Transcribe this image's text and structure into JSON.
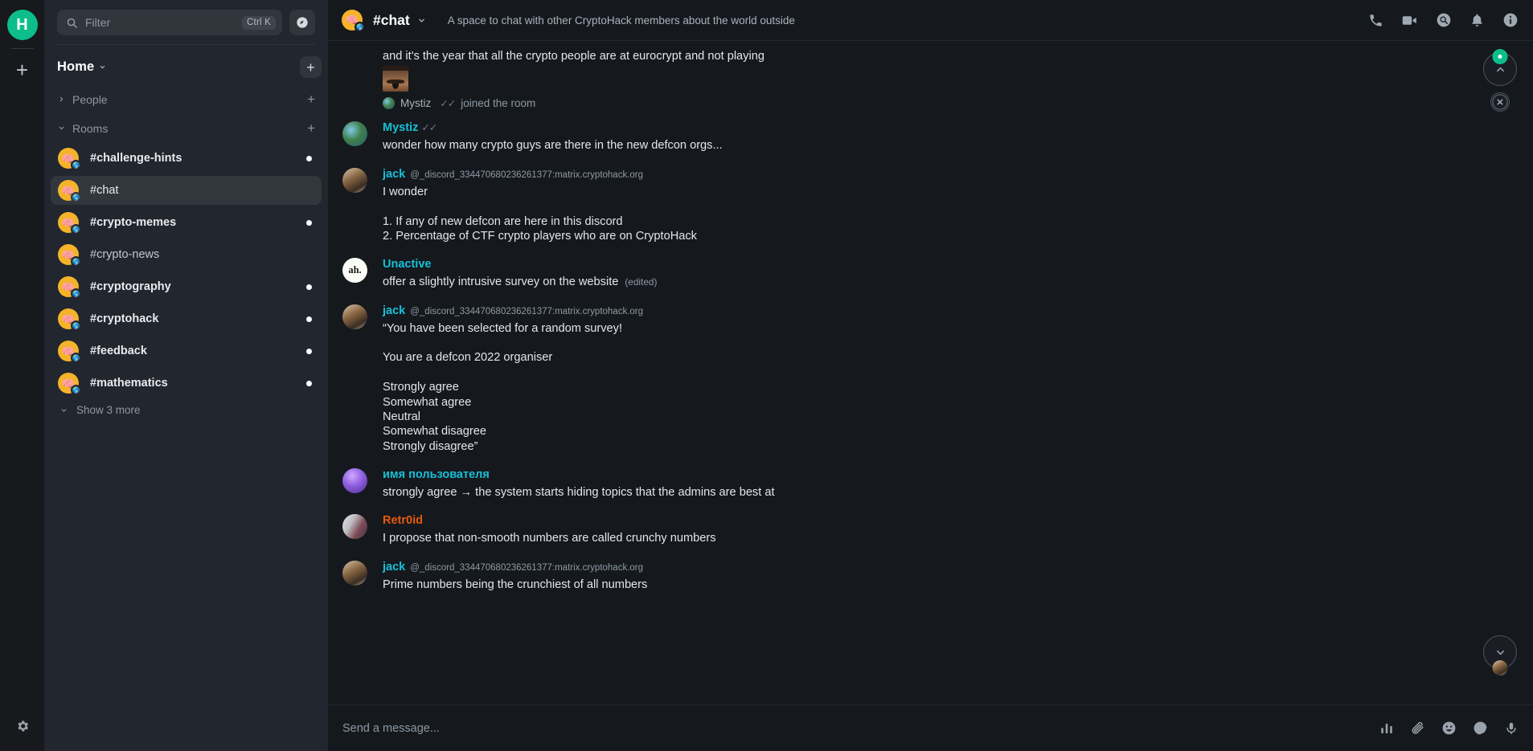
{
  "rail": {
    "home_space_label": "H",
    "add_space_label": "+",
    "settings_icon": "gear-icon"
  },
  "sidebar": {
    "search": {
      "placeholder": "Filter",
      "shortcut": "Ctrl K",
      "icon": "search-icon"
    },
    "explore_icon": "explore-compass-icon",
    "home_label": "Home",
    "home_caret_icon": "chevron-down-icon",
    "add_label": "+",
    "sections": [
      {
        "label": "People",
        "collapsed": true,
        "caret_icon": "chevron-right-icon",
        "add_label": "+"
      },
      {
        "label": "Rooms",
        "collapsed": false,
        "caret_icon": "chevron-down-icon",
        "add_label": "+"
      }
    ],
    "rooms": [
      {
        "name": "#challenge-hints",
        "unread": true,
        "selected": false,
        "avatar": "brain-emoji",
        "badge": "globe-icon"
      },
      {
        "name": "#chat",
        "unread": false,
        "selected": true,
        "avatar": "brain-emoji",
        "badge": "globe-icon"
      },
      {
        "name": "#crypto-memes",
        "unread": true,
        "selected": false,
        "avatar": "brain-emoji",
        "badge": "globe-icon"
      },
      {
        "name": "#crypto-news",
        "unread": false,
        "selected": false,
        "avatar": "brain-emoji",
        "badge": "globe-icon"
      },
      {
        "name": "#cryptography",
        "unread": true,
        "selected": false,
        "avatar": "brain-emoji",
        "badge": "globe-icon"
      },
      {
        "name": "#cryptohack",
        "unread": true,
        "selected": false,
        "avatar": "brain-emoji",
        "badge": "globe-icon"
      },
      {
        "name": "#feedback",
        "unread": true,
        "selected": false,
        "avatar": "brain-emoji",
        "badge": "globe-icon"
      },
      {
        "name": "#mathematics",
        "unread": true,
        "selected": false,
        "avatar": "brain-emoji",
        "badge": "globe-icon"
      }
    ],
    "show_more_label": "Show 3 more"
  },
  "header": {
    "room_name": "#chat",
    "room_avatar": "brain-emoji",
    "caret_icon": "chevron-down-icon",
    "topic": "A space to chat with other CryptoHack members about the world outside",
    "actions": [
      {
        "name": "voice-call-button",
        "icon": "phone-icon"
      },
      {
        "name": "video-call-button",
        "icon": "video-camera-icon"
      },
      {
        "name": "search-room-button",
        "icon": "search-circle-icon"
      },
      {
        "name": "notifications-button",
        "icon": "bell-icon"
      },
      {
        "name": "room-info-button",
        "icon": "info-circle-icon"
      }
    ]
  },
  "timeline": {
    "events": [
      {
        "type": "continuation",
        "text": "and it's the year that all the crypto people are at eurocrypt and not playing",
        "has_image": true
      },
      {
        "type": "membership",
        "user": "Mystiz",
        "checks": "✓✓",
        "text": "joined the room"
      },
      {
        "type": "message",
        "sender": "Mystiz",
        "sender_color": "#17c0d6",
        "checks": "✓✓",
        "avatar": "mystiz-avatar",
        "text": "wonder how many crypto guys are there in the new defcon orgs..."
      },
      {
        "type": "message",
        "sender": "jack",
        "sender_color": "#17c0d6",
        "mxid": "@_discord_334470680236261377:matrix.cryptohack.org",
        "avatar": "jack-avatar",
        "text": "I wonder\n\n1. If any of new defcon are here in this discord\n2. Percentage of CTF crypto players who are on CryptoHack"
      },
      {
        "type": "message",
        "sender": "Unactive",
        "sender_color": "#17c0d6",
        "avatar": "unactive-avatar",
        "avatar_text": "ah.",
        "text": "offer a slightly intrusive survey on the website",
        "edited_label": "(edited)"
      },
      {
        "type": "message",
        "sender": "jack",
        "sender_color": "#17c0d6",
        "mxid": "@_discord_334470680236261377:matrix.cryptohack.org",
        "avatar": "jack-avatar",
        "text": "“You have been selected for a random survey!\n\nYou are a defcon 2022 organiser\n\nStrongly agree\nSomewhat agree\nNeutral\nSomewhat disagree\nStrongly disagree”"
      },
      {
        "type": "message",
        "sender": "имя пользователя",
        "sender_color": "#17c0d6",
        "avatar": "imya-avatar",
        "text": "strongly agree → the system starts hiding topics that the admins are best at"
      },
      {
        "type": "message",
        "sender": "Retr0id",
        "sender_color": "#e8590c",
        "avatar": "retroid-avatar",
        "text": "I propose that non-smooth numbers are called crunchy numbers"
      },
      {
        "type": "message",
        "sender": "jack",
        "sender_color": "#17c0d6",
        "mxid": "@_discord_334470680236261377:matrix.cryptohack.org",
        "avatar": "jack-avatar",
        "text": "Prime numbers being the crunchiest of all numbers"
      }
    ],
    "jump_to_unread": {
      "icon": "chevron-up-icon",
      "has_unread_badge": true
    },
    "close_jump": {
      "icon": "close-circle-icon"
    },
    "scroll_to_bottom": {
      "icon": "chevron-down-icon",
      "read_receipt_avatar": "jack-avatar"
    }
  },
  "composer": {
    "placeholder": "Send a message...",
    "actions": [
      {
        "name": "poll-button",
        "icon": "poll-bars-icon"
      },
      {
        "name": "attachment-button",
        "icon": "paperclip-icon"
      },
      {
        "name": "emoji-button",
        "icon": "emoji-smiley-icon"
      },
      {
        "name": "sticker-button",
        "icon": "sticker-icon"
      },
      {
        "name": "voice-message-button",
        "icon": "microphone-icon"
      }
    ]
  },
  "colors": {
    "accent_green": "#0dbd8b",
    "sender_cyan": "#17c0d6",
    "sender_orange": "#e8590c",
    "room_avatar": "#f5b32a",
    "panel_bg": "#22262e",
    "main_bg": "#15191e",
    "rail_bg": "#17191c"
  }
}
